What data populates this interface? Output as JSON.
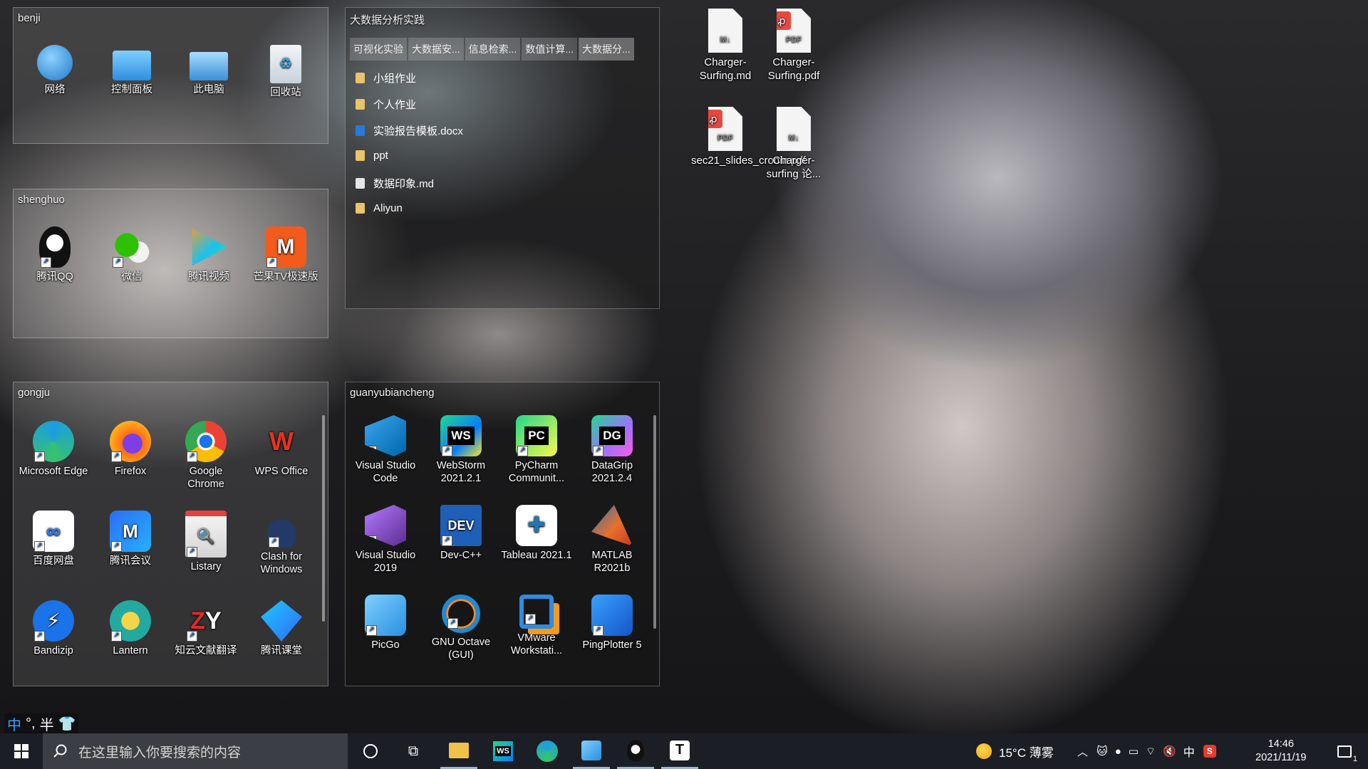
{
  "desktop": {
    "fences": {
      "benji": {
        "title": "benji",
        "items": [
          "网络",
          "控制面板",
          "此电脑",
          "回收站"
        ]
      },
      "shenghuo": {
        "title": "shenghuo",
        "items": [
          "腾讯QQ",
          "微信",
          "腾讯视频",
          "芒果TV极速版"
        ]
      },
      "gongju": {
        "title": "gongju",
        "items": [
          "Microsoft Edge",
          "Firefox",
          "Google Chrome",
          "WPS Office",
          "百度网盘",
          "腾讯会议",
          "Listary",
          "Clash for Windows",
          "Bandizip",
          "Lantern",
          "知云文献翻译",
          "腾讯课堂"
        ]
      },
      "guanyubiancheng": {
        "title": "guanyubiancheng",
        "items": [
          "Visual Studio Code",
          "WebStorm 2021.2.1",
          "PyCharm Communit...",
          "DataGrip 2021.2.4",
          "Visual Studio 2019",
          "Dev-C++",
          "Tableau 2021.1",
          "MATLAB R2021b",
          "PicGo",
          "GNU Octave (GUI)",
          "VMware Workstati...",
          "PingPlotter 5"
        ]
      },
      "explorer": {
        "title": "大数据分析实践",
        "tabs": [
          "可视化实验",
          "大数据安...",
          "信息检索...",
          "数值计算...",
          "大数据分..."
        ],
        "files": [
          "小组作业",
          "个人作业",
          "实验报告模板.docx",
          "ppt",
          "数据印象.md",
          "Aliyun"
        ]
      }
    },
    "loose_files": [
      "Charger-Surfing.md",
      "Charger-Surfing.pdf",
      "sec21_slides_cronin.pdf",
      "Charger-surfing 论..."
    ],
    "file_badges": {
      "pdf": "PDF",
      "md": "M↓"
    }
  },
  "ime_bar": {
    "mode": "中",
    "punct": "°,",
    "width": "半"
  },
  "taskbar": {
    "search_placeholder": "在这里输入你要搜索的内容",
    "weather": "15°C 薄雾",
    "lang": "中",
    "time": "14:46",
    "date": "2021/11/19",
    "notifications": "1"
  },
  "colors": {
    "accent": "#0078d4",
    "taskbar": "#1b1e24"
  }
}
